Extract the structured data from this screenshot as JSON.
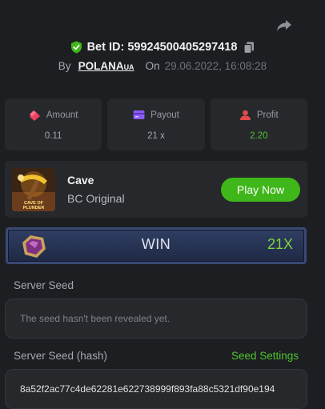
{
  "header": {
    "share_icon": "share-icon",
    "bet_id_text": "Bet ID: 59924500405297418",
    "by_label": "By",
    "username": "POLANA",
    "username_suffix": "UA",
    "on_label": "On",
    "date": "29.06.2022, 16:08:28"
  },
  "stats": [
    {
      "label": "Amount",
      "value": "0.11",
      "icon": "coins-icon",
      "color": "#e8415e"
    },
    {
      "label": "Payout",
      "value": "21 x",
      "icon": "card-icon",
      "color": "#8a5cf6"
    },
    {
      "label": "Profit",
      "value": "2.20",
      "icon": "profit-icon",
      "color": "#e34a4a"
    }
  ],
  "game": {
    "name": "Cave",
    "subtitle": "BC Original",
    "play_label": "Play Now",
    "thumb_text": "CAVE OF PLUNDER"
  },
  "result": {
    "label": "WIN",
    "multiplier": "21X"
  },
  "server_seed": {
    "label": "Server Seed",
    "placeholder": "The seed hasn't been revealed yet."
  },
  "server_seed_hash": {
    "label": "Server Seed (hash)",
    "settings_link": "Seed Settings",
    "value": "8a52f2ac77c4de62281e622738999f893fa88c5321df90e194"
  },
  "colors": {
    "accent_green": "#3fb71a",
    "background": "#1c1e22",
    "panel": "#26282c"
  }
}
